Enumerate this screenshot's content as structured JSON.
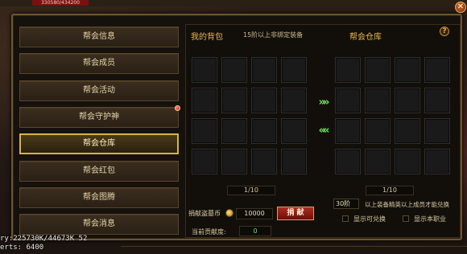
{
  "hud": {
    "hp_text": "330580/434200"
  },
  "menu": {
    "items": [
      {
        "label": "帮会信息"
      },
      {
        "label": "帮会成员"
      },
      {
        "label": "帮会活动"
      },
      {
        "label": "帮会守护神"
      },
      {
        "label": "帮会仓库"
      },
      {
        "label": "帮会红包"
      },
      {
        "label": "帮会图腾"
      },
      {
        "label": "帮会消息"
      }
    ],
    "active_index": 4
  },
  "bag": {
    "title": "我的背包",
    "note": "15阶以上非绑定装备",
    "page": "1/10"
  },
  "warehouse": {
    "title": "帮会仓库",
    "page": "1/10",
    "level_value": "30阶",
    "level_note": "以上装备精英以上成员才能兑换",
    "show_exchangeable_label": "显示可兑换",
    "show_class_label": "显示本职业"
  },
  "donate": {
    "coin_label": "捐献盗墓币",
    "coin_value": "10000",
    "button_label": "捐 献",
    "contrib_label": "当前贡献度:",
    "contrib_value": "0"
  },
  "debug": {
    "line1": "ry:225730K/44673K 52",
    "line2": "erts:   6400"
  },
  "colors": {
    "accent": "#e8b64a",
    "active_border": "#d8b24a",
    "donate": "#b02a20",
    "arrow": "#6de25a"
  },
  "icons": {
    "close": "close-icon",
    "help": "help-icon",
    "arrow_right": "double-arrow-right-icon",
    "arrow_left": "double-arrow-left-icon",
    "coin": "coin-icon"
  }
}
